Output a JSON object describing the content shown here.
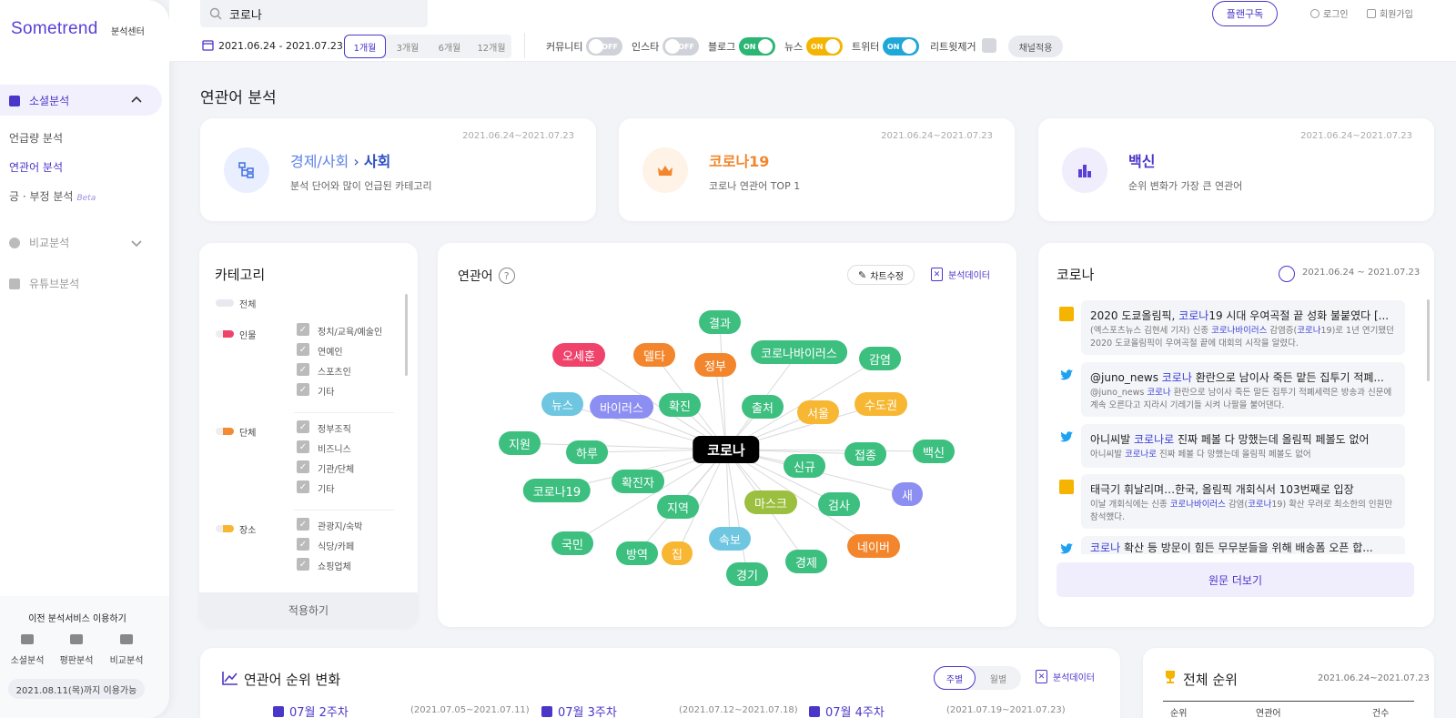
{
  "brand": {
    "name": "Sometrend",
    "sub": "분석센터"
  },
  "search": {
    "value": "코로나"
  },
  "header": {
    "date_range": "2021.06.24 - 2021.07.23",
    "periods": [
      "1개월",
      "3개월",
      "6개월",
      "12개월"
    ],
    "active_period": "1개월",
    "toggles": [
      {
        "label": "커뮤니티",
        "state": "OFF",
        "color": "#cfd2d9"
      },
      {
        "label": "인스타",
        "state": "OFF",
        "color": "#cfd2d9"
      },
      {
        "label": "블로그",
        "state": "ON",
        "color": "#2bb673"
      },
      {
        "label": "뉴스",
        "state": "ON",
        "color": "#f5b400"
      },
      {
        "label": "트위터",
        "state": "ON",
        "color": "#1fa7d8"
      }
    ],
    "retweet_label": "리트윗제거",
    "channel_apply": "채널적용",
    "plan_button": "플랜구독",
    "login": "로그인",
    "signup": "회원가입"
  },
  "sidebar": {
    "groups": [
      "소셜분석",
      "비교분석",
      "유튜브분석"
    ],
    "sub_items": [
      "언급량 분석",
      "연관어 분석",
      "긍 · 부정 분석"
    ],
    "beta": "Beta",
    "bottom_title": "이전 분석서비스 이용하기",
    "bottom_items": [
      "소셜분석",
      "평판분석",
      "비교분석"
    ],
    "until": "2021.08.11(목)까지 이용가능"
  },
  "page_title": "연관어 분석",
  "summary": [
    {
      "date": "2021.06.24~2021.07.23",
      "title_a": "경제/사회",
      "title_b": "사회",
      "desc": "분석 단어와 많이 언급된 카테고리",
      "icon": "category-tree-icon"
    },
    {
      "date": "2021.06.24~2021.07.23",
      "title": "코로나19",
      "desc": "코로나 연관어 TOP 1",
      "icon": "crown-icon"
    },
    {
      "date": "2021.06.24~2021.07.23",
      "title": "백신",
      "desc": "순위 변화가 가장 큰 연관어",
      "icon": "bar-chart-icon"
    }
  ],
  "category": {
    "title": "카테고리",
    "all": "전체",
    "groups": [
      {
        "name": "인물",
        "color": "#f0436b",
        "items": [
          "정치/교육/예술인",
          "연예인",
          "스포츠인",
          "기타"
        ]
      },
      {
        "name": "단체",
        "color": "#f38b34",
        "items": [
          "정부조직",
          "비즈니스",
          "기관/단체",
          "기타"
        ]
      },
      {
        "name": "장소",
        "color": "#f7b733",
        "items": [
          "관광지/숙박",
          "식당/카페",
          "쇼핑업체"
        ]
      }
    ],
    "apply": "적용하기"
  },
  "network": {
    "title": "연관어",
    "edit": "차트수정",
    "data": "분석데이터",
    "center": "코로나"
  },
  "news": {
    "title": "코로나",
    "date": "2021.06.24 ~ 2021.07.23",
    "more": "원문 더보기"
  },
  "bottom": {
    "rank_title": "연관어 순위 변화",
    "tabs": [
      "주별",
      "월별"
    ],
    "data": "분석데이터",
    "weeks": [
      {
        "label": "07월 2주차",
        "range": "(2021.07.05~2021.07.11)"
      },
      {
        "label": "07월 3주차",
        "range": "(2021.07.12~2021.07.18)"
      },
      {
        "label": "07월 4주차",
        "range": "(2021.07.19~2021.07.23)"
      }
    ],
    "total_title": "전체 순위",
    "total_date": "2021.06.24~2021.07.23",
    "cols": [
      "순위",
      "연관어",
      "건수"
    ]
  }
}
